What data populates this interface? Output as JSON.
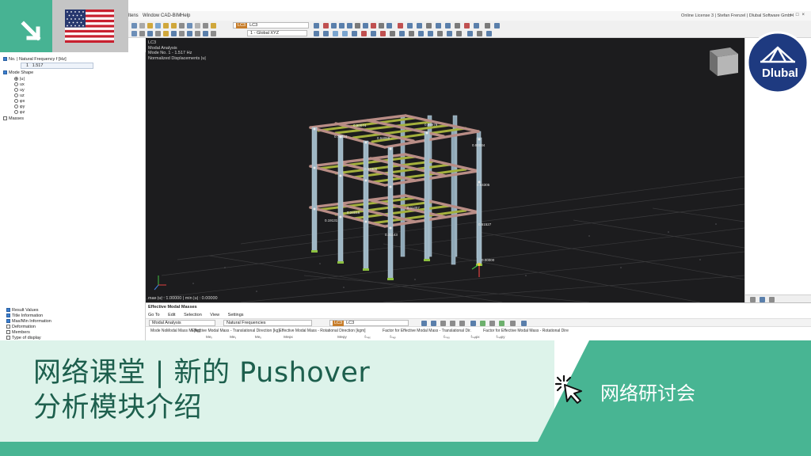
{
  "menubar": {
    "items": [
      "ltens",
      "Window",
      "CAD-BIM",
      "Help"
    ],
    "license": "Online License 3 | Stefan Frenzel | Dlubal Software GmbH"
  },
  "toolbar": {
    "loadcase_tag": "LC3",
    "loadcase_value": "LC3",
    "view_combo": "1 - Global XYZ"
  },
  "left_panel": {
    "items": [
      {
        "label": "No. | Natural Frequency f [Hz]",
        "checked": true
      },
      {
        "label": "Mode Shape",
        "checked": true
      },
      {
        "label": "Masses",
        "checked": false
      }
    ],
    "frequency_value": "1",
    "frequency_number": "1.517",
    "mode_shape_options": [
      "|u|",
      "ux",
      "uy",
      "uz",
      "φx",
      "φy",
      "φz"
    ],
    "mode_shape_selected": "|u|",
    "bottom_items": [
      {
        "label": "Result Values",
        "checked": true
      },
      {
        "label": "Title Information",
        "checked": true
      },
      {
        "label": "Max/Min Information",
        "checked": true
      },
      {
        "label": "Deformation",
        "checked": false
      },
      {
        "label": "Members",
        "checked": false
      },
      {
        "label": "Type of display",
        "checked": false
      }
    ]
  },
  "viewport": {
    "info_lines": [
      "LC3",
      "Modal Analysis",
      "Mode No. 1 - 1.517 Hz",
      "Normalized Displacements |u|"
    ],
    "status": "max |u| : 1.00000 | min |u| : 0.00000",
    "labels": [
      "0.99979",
      "0.90074",
      "0.70934",
      "0.64059",
      "0.90034",
      "0.52306",
      "0.84305",
      "0.11457",
      "0.00000",
      "0.24016",
      "0.61527",
      "0.31143",
      "0.19131"
    ]
  },
  "table_panel": {
    "title": "Effective Modal Masses",
    "menu": [
      "Go To",
      "Edit",
      "Selection",
      "View",
      "Settings"
    ],
    "analysis_combo": "Modal Analysis",
    "results_combo": "Natural Frequencies",
    "loadcase_tag": "LC3",
    "loadcase_value": "LC3",
    "headers": [
      {
        "top": "Mode No.",
        "sub": ""
      },
      {
        "top": "Modal Mass Mi [kg]",
        "sub": ""
      },
      {
        "top": "Effective Modal Mass - Translational Direction [kg]",
        "sub": "Meₓ"
      },
      {
        "top": "",
        "sub": "Meᵧ"
      },
      {
        "top": "",
        "sub": "Meᵤ"
      },
      {
        "top": "Effective Modal Mass - Rotational Direction [kgm]",
        "sub": "Meφx"
      },
      {
        "top": "",
        "sub": "Meφy"
      },
      {
        "top": "Factor for Effective Modal Mass - Translational Dir.",
        "sub": "fₘₑₓ"
      },
      {
        "top": "",
        "sub": "fₘₑᵧ"
      },
      {
        "top": "",
        "sub": "fₘₑᵤ"
      },
      {
        "top": "Factor for Effective Modal Mass - Rotational Dire",
        "sub": "fₘₑφx"
      },
      {
        "top": "",
        "sub": "fₘₑφy"
      }
    ]
  },
  "banner": {
    "headline_line1": "网络课堂 | 新的 Pushover",
    "headline_line2": "分析模块介绍",
    "tag": "网络研讨会"
  },
  "logo": {
    "text": "Dlubal"
  },
  "colors": {
    "teal": "#48b593",
    "banner_light": "#ddf3ea",
    "headline": "#1d5f4d",
    "logo_blue": "#1e3a80"
  },
  "icons": [
    "arrow-down-right-icon",
    "us-flag-icon",
    "cursor-click-icon",
    "dlubal-bridge-icon",
    "view-cube-icon"
  ]
}
